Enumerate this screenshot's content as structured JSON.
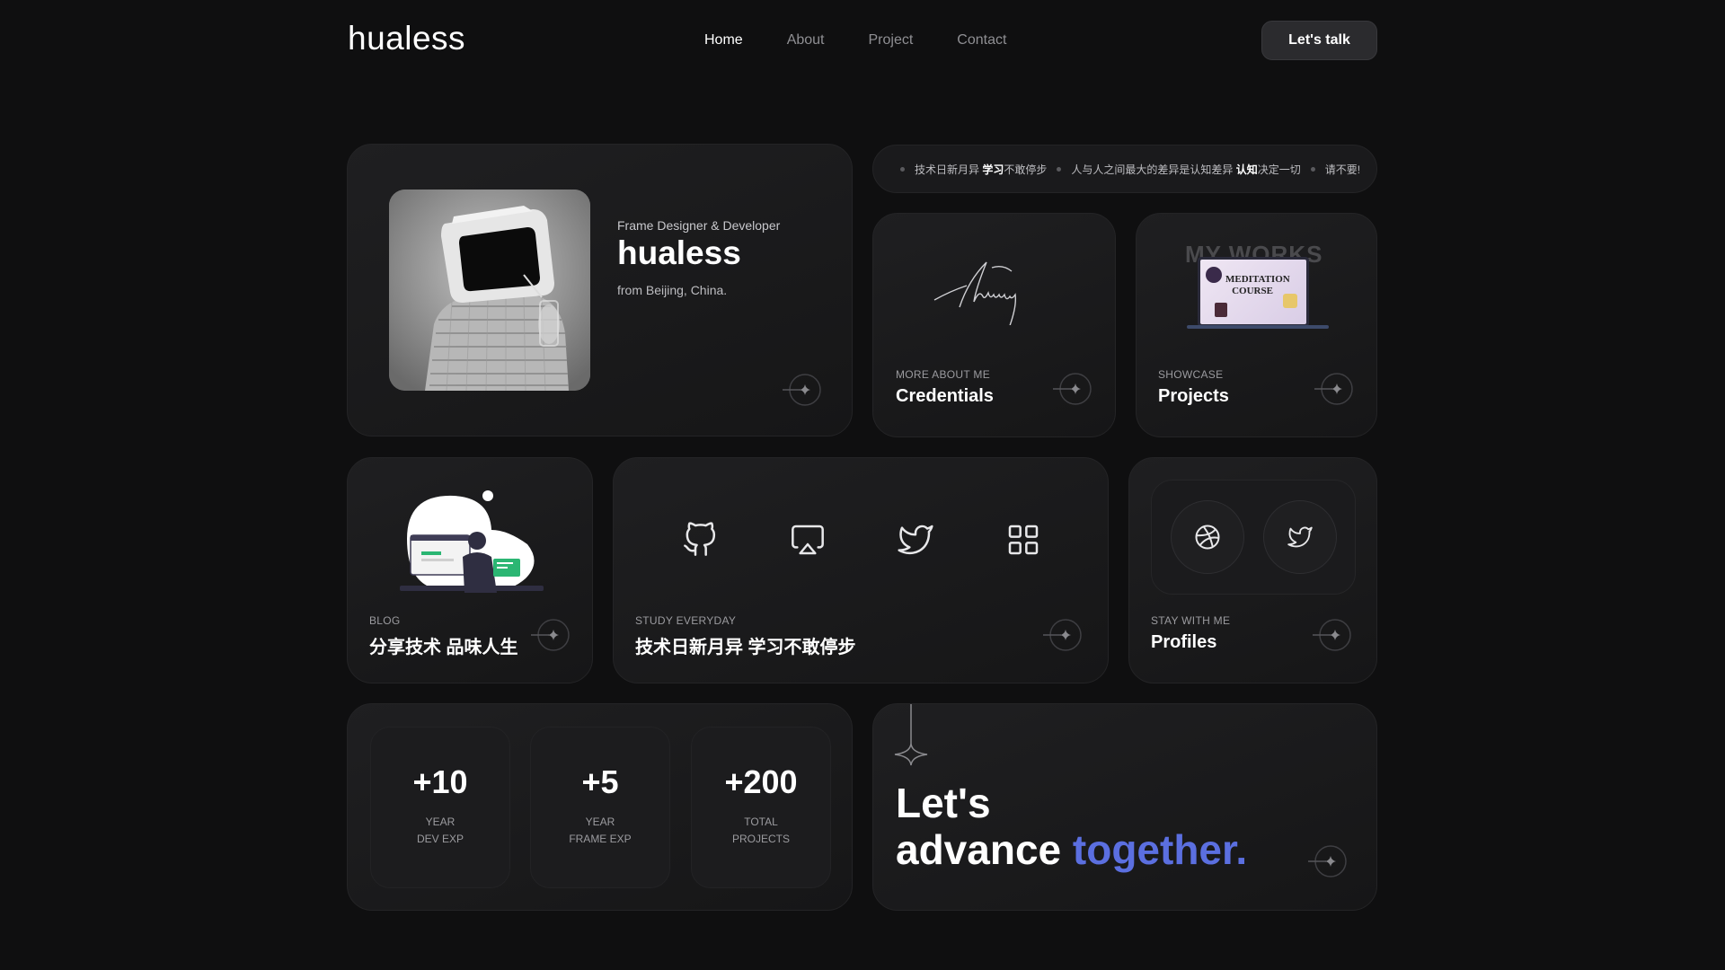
{
  "header": {
    "logo": "hualess",
    "nav": [
      {
        "label": "Home",
        "active": true
      },
      {
        "label": "About",
        "active": false
      },
      {
        "label": "Project",
        "active": false
      },
      {
        "label": "Contact",
        "active": false
      }
    ],
    "cta_label": "Let's talk"
  },
  "profile": {
    "role": "Frame Designer & Developer",
    "name": "hualess",
    "location": "from Beijing, China."
  },
  "marquee": {
    "items": [
      {
        "pre": "技术日新月异 ",
        "bold": "学习",
        "post": "不敢停步"
      },
      {
        "pre": "人与人之间最大的差异是认知差异 ",
        "bold": "认知",
        "post": "决定一切"
      },
      {
        "pre": "请不要!",
        "bold": "",
        "post": ""
      }
    ]
  },
  "credentials": {
    "eyebrow": "MORE ABOUT ME",
    "title": "Credentials"
  },
  "projects": {
    "eyebrow": "SHOWCASE",
    "title": "Projects",
    "thumb_heading": "MY WORKS",
    "thumb_line1": "MEDITATION",
    "thumb_line2": "COURSE"
  },
  "blog": {
    "eyebrow": "BLOG",
    "title": "分享技术 品味人生"
  },
  "study": {
    "eyebrow": "STUDY EVERYDAY",
    "title": "技术日新月异 学习不敢停步",
    "icons": [
      "github-icon",
      "airplay-icon",
      "twitter-icon",
      "grid-icon"
    ]
  },
  "profiles": {
    "eyebrow": "STAY WITH ME",
    "title": "Profiles",
    "icons": [
      "dribbble-icon",
      "twitter-icon"
    ]
  },
  "stats": [
    {
      "value": "+10",
      "line1": "YEAR",
      "line2": "DEV EXP"
    },
    {
      "value": "+5",
      "line1": "YEAR",
      "line2": "FRAME EXP"
    },
    {
      "value": "+200",
      "line1": "TOTAL",
      "line2": "PROJECTS"
    }
  ],
  "cta_card": {
    "line1": "Let's",
    "line2_pre": "advance ",
    "line2_highlight": "together."
  },
  "colors": {
    "background": "#0f0f10",
    "card": "#1f1f21",
    "accent": "#5b6fe0"
  }
}
